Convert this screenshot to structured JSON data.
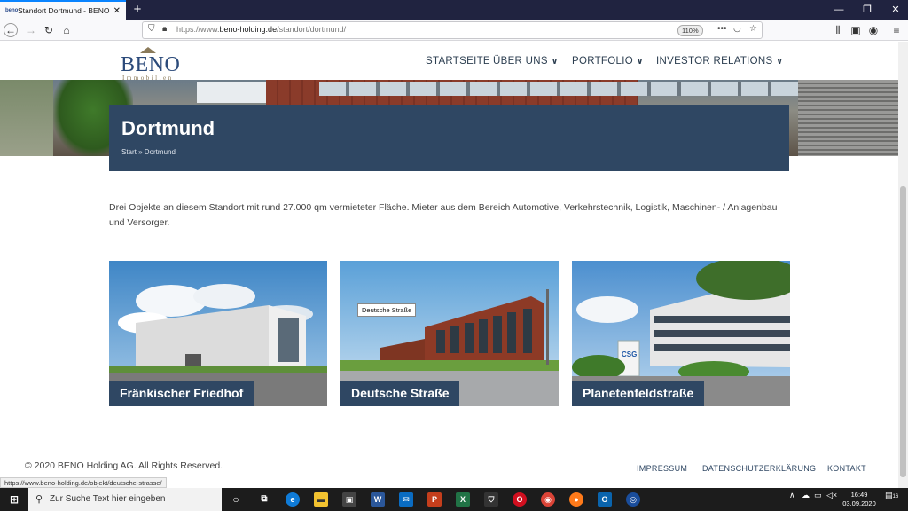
{
  "browser": {
    "tab_title": "Standort Dortmund - BENO H",
    "favicon_text": "beno",
    "url_prefix": "https://www.",
    "url_domain": "beno-holding.de",
    "url_path": "/standort/dortmund/",
    "zoom": "110%",
    "status_url": "https://www.beno-holding.de/objekt/deutsche-strasse/"
  },
  "site": {
    "logo_main": "BENO",
    "logo_sub": "Immobilien",
    "nav": [
      {
        "label": "STARTSEITE"
      },
      {
        "label": "ÜBER UNS"
      },
      {
        "label": "PORTFOLIO"
      },
      {
        "label": "INVESTOR RELATIONS"
      }
    ]
  },
  "page": {
    "title": "Dortmund",
    "breadcrumb": "Start » Dortmund",
    "intro": "Drei Objekte an diesem Standort mit rund 27.000 qm vermieteter Fläche. Mieter aus dem Bereich Automotive, Verkehrstechnik, Logistik, Maschinen- / Anlagenbau und Versorger.",
    "cards": [
      {
        "label": "Fränkischer Friedhof"
      },
      {
        "label": "Deutsche Straße"
      },
      {
        "label": "Planetenfeldstraße"
      }
    ],
    "tooltip": "Deutsche Straße"
  },
  "footer": {
    "copyright": "© 2020 BENO Holding AG. All Rights Reserved.",
    "links": [
      {
        "label": "IMPRESSUM"
      },
      {
        "label": "DATENSCHUTZERKLÄRUNG"
      },
      {
        "label": "KONTAKT"
      }
    ]
  },
  "taskbar": {
    "search_placeholder": "Zur Suche Text hier eingeben",
    "time": "16:49",
    "date": "03.09.2020",
    "notification_count": "16"
  }
}
